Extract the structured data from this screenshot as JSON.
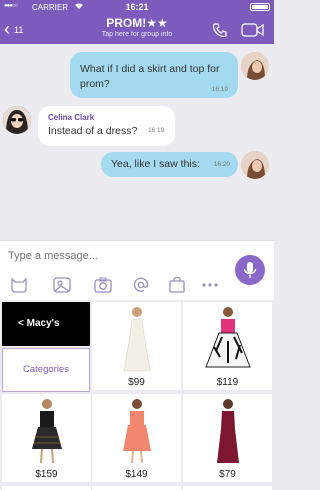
{
  "status_bar": {
    "signal": "●●●○○",
    "carrier": "CARRIER",
    "time": "16:21"
  },
  "header": {
    "back_count": "11",
    "title": "PROM!★★",
    "subtitle": "Tap here for group info"
  },
  "messages": [
    {
      "text": "What if I did a skirt and top for prom?",
      "time": "16:19"
    },
    {
      "sender": "Celina Clark",
      "text": "Instead of a dress?",
      "time": "16:19"
    },
    {
      "text": "Yea, like I saw this:",
      "time": "16:20"
    }
  ],
  "composer": {
    "placeholder": "Type a message...",
    "icons": [
      "sticker-icon",
      "image-icon",
      "camera-icon",
      "mention-icon",
      "shopping-bag-icon",
      "more-icon"
    ]
  },
  "store": {
    "store_button": "< Macy's",
    "categories_button": "Categories",
    "products": [
      {
        "price": "$99",
        "dress_color": "#f1efe6"
      },
      {
        "price": "$119",
        "dress_color": "#e0337c"
      },
      {
        "price": "$159",
        "dress_color": "#1a1a1a"
      },
      {
        "price": "$149",
        "dress_color": "#f2876f"
      },
      {
        "price": "$79",
        "dress_color": "#7d1630"
      }
    ]
  },
  "colors": {
    "accent": "#7d5bbd",
    "outgoing_bubble": "#a4daf0",
    "incoming_bubble": "#ffffff"
  }
}
